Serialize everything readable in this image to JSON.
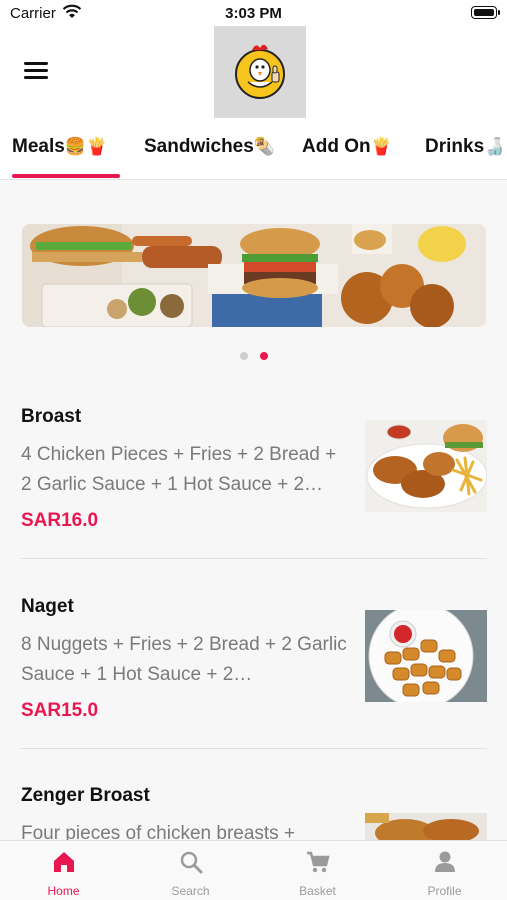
{
  "status_bar": {
    "carrier": "Carrier",
    "time": "3:03 PM",
    "wifi_icon": "wifi-icon",
    "battery_icon": "battery-icon"
  },
  "header": {
    "menu_icon": "hamburger-menu-icon",
    "logo": "chicken-thumbs-up-logo"
  },
  "categories": [
    {
      "label": "Meals",
      "emoji": "🍔🍟",
      "active": true
    },
    {
      "label": "Sandwiches",
      "emoji": "🌯"
    },
    {
      "label": "Add On",
      "emoji": "🍟"
    },
    {
      "label": "Drinks",
      "emoji": "🍶"
    }
  ],
  "banner": {
    "slides": 2,
    "active_slide": 2
  },
  "menu_items": [
    {
      "title": "Broast",
      "description": "4 Chicken Pieces + Fries + 2 Bread + 2 Garlic Sauce + 1 Hot Sauce + 2…",
      "price": "SAR16.0"
    },
    {
      "title": "Naget",
      "description": "8 Nuggets + Fries + 2 Bread + 2 Garlic Sauce + 1 Hot Sauce + 2…",
      "price": "SAR15.0"
    },
    {
      "title": "Zenger Broast",
      "description": "Four pieces of chicken breasts +"
    }
  ],
  "bottom_tabs": [
    {
      "label": "Home",
      "icon": "home-icon",
      "active": true
    },
    {
      "label": "Search",
      "icon": "search-icon"
    },
    {
      "label": "Basket",
      "icon": "cart-icon"
    },
    {
      "label": "Profile",
      "icon": "profile-icon"
    }
  ],
  "colors": {
    "accent": "#e8174f",
    "inactive": "#9b9b9b"
  }
}
